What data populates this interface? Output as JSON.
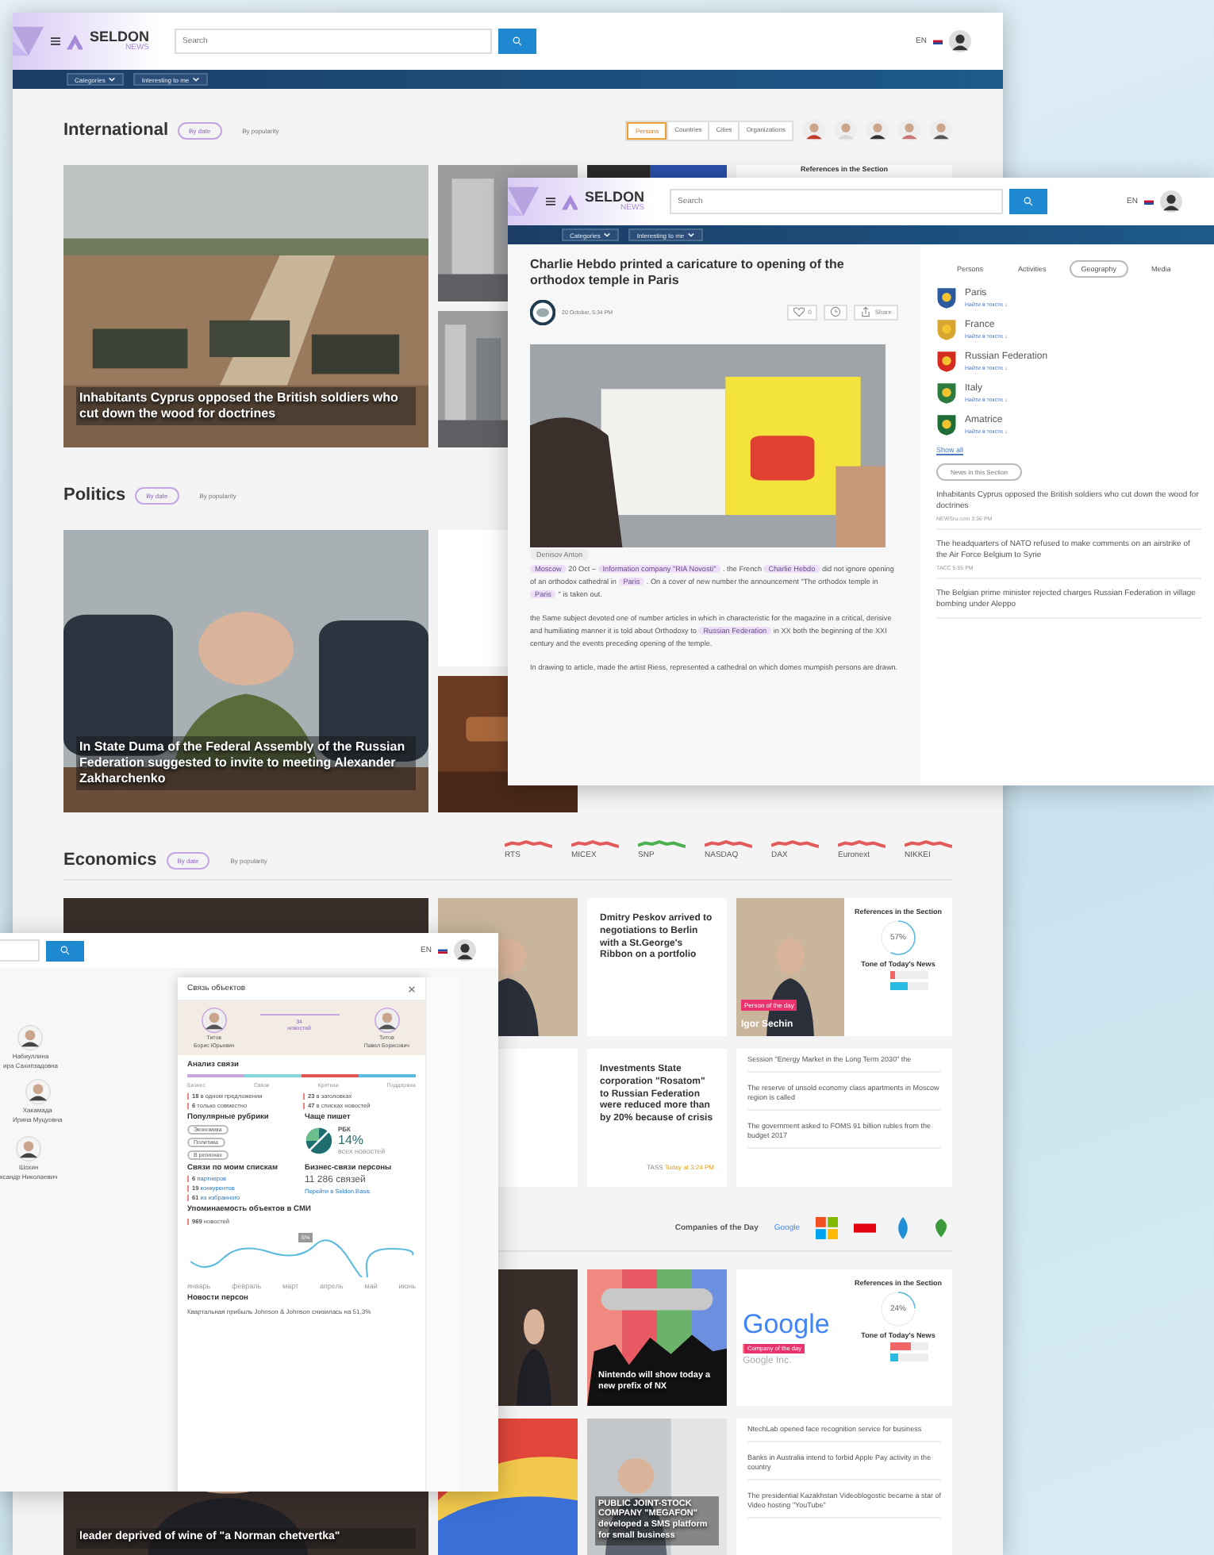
{
  "main": {
    "logo": "SELDON",
    "logo_sub": "NEWS",
    "search": {
      "placeholder": "Search"
    },
    "language": "EN",
    "nav": [
      "Categories",
      "Interesting to me"
    ],
    "international": {
      "title": "International",
      "sorts": [
        {
          "label": "By date",
          "selected": true
        },
        {
          "label": "By popularity",
          "selected": false
        }
      ],
      "filters": [
        {
          "label": "Persons",
          "selected": true
        },
        {
          "label": "Countries",
          "selected": false
        },
        {
          "label": "Cities",
          "selected": false
        },
        {
          "label": "Organizations",
          "selected": false
        }
      ],
      "lead": "Inhabitants Cyprus opposed the British soldiers who cut down the wood for doctrines",
      "refs": "References in the Section"
    },
    "politics": {
      "title": "Politics",
      "sorts": [
        {
          "label": "By date",
          "selected": true
        },
        {
          "label": "By popularity",
          "selected": false
        }
      ],
      "lead": "In State Duma of the Federal Assembly of the Russian Federation suggested to invite to meeting Alexander Zakharchenko"
    },
    "economics": {
      "title": "Economics",
      "sorts": [
        {
          "label": "By date",
          "selected": true
        },
        {
          "label": "By popularity",
          "selected": false
        }
      ],
      "markets": [
        {
          "name": "RTS",
          "color": "#e35b5b"
        },
        {
          "name": "MICEX",
          "color": "#e35b5b"
        },
        {
          "name": "SNP",
          "color": "#4caf50"
        },
        {
          "name": "NASDAQ",
          "color": "#e35b5b"
        },
        {
          "name": "DAX",
          "color": "#e35b5b"
        },
        {
          "name": "Euronext",
          "color": "#e35b5b"
        },
        {
          "name": "NIKKEI",
          "color": "#e35b5b"
        }
      ],
      "peskov": "Dmitry Peskov arrived to negotiations to Berlin with a St.George's Ribbon on a portfolio",
      "person": {
        "badge": "Person of the day",
        "name": "Igor Sechin",
        "refs": "References in the Section",
        "percent": "57%",
        "tone": "Tone of Today's News",
        "tone_bars": [
          {
            "kind": "negative",
            "level": 0.12
          },
          {
            "kind": "positive",
            "level": 0.45
          }
        ]
      },
      "rosatom": {
        "title": "Investments State corporation \"Rosatom\" to Russian Federation were reduced more than by 20% because of crisis",
        "source": "TASS",
        "time": "Today at 3:24 PM"
      },
      "news": [
        "Session \"Energy Market in the Long Term 2030\" the",
        "The reserve of unsold economy class apartments in Moscow region is called",
        "The government asked to FOMS 91 billion rubles from the budget 2017"
      ]
    },
    "companies": {
      "title": "Companies of the Day",
      "logos": [
        {
          "kind": "google",
          "label": "Google"
        },
        {
          "kind": "windows"
        },
        {
          "kind": "mts"
        },
        {
          "kind": "drop"
        },
        {
          "kind": "leaf"
        }
      ]
    },
    "nintendo": "Nintendo will show today a new prefix of NX",
    "company": {
      "logo": "Google",
      "badge": "Company of the day",
      "name": "Google Inc.",
      "refs": "References in the Section",
      "percent": "24%",
      "tone": "Tone of Today's News",
      "tone_bars": [
        {
          "kind": "negative",
          "level": 0.55
        },
        {
          "kind": "positive",
          "level": 0.2
        }
      ]
    },
    "megafon": "PUBLIC JOINT-STOCK COMPANY \"MEGAFON\" developed a SMS platform for small business",
    "news2": [
      "NtechLab opened face recognition service for business",
      "Banks in Australia intend to forbid Apple Pay activity in the country",
      "The presidential Kazakhstan Videoblogostic became a star of Video hosting \"YouTube\""
    ],
    "bottom_lead": "leader deprived of wine of \"a Norman chetvertka\""
  },
  "article": {
    "logo": "SELDON",
    "logo_sub": "NEWS",
    "search": {
      "placeholder": "Search"
    },
    "language": "EN",
    "nav": [
      "Categories",
      "Interesting to me"
    ],
    "title": "Charlie Hebdo printed a caricature to opening of the orthodox temple in Paris",
    "date": "20 October, 5:34 PM",
    "likes": "0",
    "share": "Share",
    "caption": "Denisov Anton",
    "paragraphs": [
      [
        {
          "t": "Moscow",
          "tag": true
        },
        {
          "t": " 20 Oct – ",
          "tag": false
        },
        {
          "t": "Information company \"RIA Novosti\"",
          "tag": true
        },
        {
          "t": " . the French ",
          "tag": false
        },
        {
          "t": "Charlie Hebdo",
          "tag": true
        },
        {
          "t": " did not ignore opening of an orthodox cathedral in ",
          "tag": false
        },
        {
          "t": "Paris",
          "tag": true
        },
        {
          "t": " . On a cover of new number the announcement \"The orthodox temple in ",
          "tag": false
        },
        {
          "t": "Paris",
          "tag": true
        },
        {
          "t": " \" is taken out.",
          "tag": false
        }
      ],
      [
        {
          "t": "the Same subject devoted one of number articles in which in characteristic for the magazine in a critical, derisive and humiliating manner it is told about Orthodoxy to ",
          "tag": false
        },
        {
          "t": "Russian Federation",
          "tag": true
        },
        {
          "t": " in XX both the beginning of the XXI century and the events preceding opening of the temple.",
          "tag": false
        }
      ],
      [
        {
          "t": "In drawing to article, made the artist Riess, represented a cathedral on which domes mumpish persons are drawn.",
          "tag": false
        }
      ]
    ],
    "tabs": [
      {
        "label": "Persons",
        "selected": false
      },
      {
        "label": "Activities",
        "selected": false
      },
      {
        "label": "Geography",
        "selected": true
      },
      {
        "label": "Media",
        "selected": false
      }
    ],
    "places": [
      {
        "name": "Paris",
        "color": "#2c5aa0",
        "find": "Найти в тексте ↓"
      },
      {
        "name": "France",
        "color": "#d9a531",
        "find": "Найти в тексте ↓"
      },
      {
        "name": "Russian Federation",
        "color": "#d52b1e",
        "find": "Найти в тексте ↓"
      },
      {
        "name": "Italy",
        "color": "#2c7a3e",
        "find": "Найти в тексте ↓"
      },
      {
        "name": "Amatrice",
        "color": "#1f6e35",
        "find": "Найти в тексте ↓"
      }
    ],
    "show_all": "Show all",
    "section_button": "News in this Section",
    "news": [
      {
        "title": "Inhabitants Cyprus opposed the British soldiers who cut down the wood for doctrines",
        "source": "NEWSru.com 3:56 PM"
      },
      {
        "title": "The headquarters of NATO refused to make comments on an airstrike of the Air Force Belgium to Syrie",
        "source": "ТАСС 5:55 PM"
      },
      {
        "title": "The Belgian prime minister rejected charges Russian Federation in village bombing under Aleppo"
      }
    ]
  },
  "connections": {
    "language": "EN",
    "graph": [
      {
        "surname": "Набиуллина",
        "given": "ира Сахипзадовна"
      },
      {
        "surname": "Хакамада",
        "given": "Ирина Муцуовна"
      },
      {
        "surname": "Шохин",
        "given": "ксандр Николаевич"
      }
    ],
    "title": "Связь объектов",
    "left": {
      "surname": "Титов",
      "name": "Борис Юрьевич"
    },
    "right": {
      "surname": "Титов",
      "name": "Павел Борисович"
    },
    "count": "34",
    "count_label": "новостей",
    "analysis": "Анализ связи",
    "segments": [
      {
        "color": "#c9a6dc"
      },
      {
        "color": "#86d6dc"
      },
      {
        "color": "#e0574f"
      },
      {
        "color": "#5bbbe0"
      }
    ],
    "segment_labels": [
      "Бизнес",
      "Связи",
      "Критика",
      "Поддержка"
    ],
    "stats": [
      {
        "n": "18",
        "t": "в одном предложении"
      },
      {
        "n": "23",
        "t": "в заголовках"
      },
      {
        "n": "6",
        "t": "только совместно"
      },
      {
        "n": "47",
        "t": "в списках новостей"
      }
    ],
    "rubrics_title": "Популярные рубрики",
    "rubrics": [
      "Экономика",
      "Политика",
      "В регионах"
    ],
    "writes_title": "Чаще пишет",
    "writes_source": "РБК",
    "writes_percent": "14%",
    "writes_note": "всех новостей",
    "lists_title": "Связи по моим спискам",
    "lists": [
      {
        "n": "6",
        "t": "партнеров"
      },
      {
        "n": "19",
        "t": "конкурентов"
      },
      {
        "n": "61",
        "t": "из избранного"
      }
    ],
    "business_title": "Бизнес-связи персоны",
    "business_count": "11 286 связей",
    "business_link": "Перейти в Seldon.Basis",
    "mentions_title": "Упоминаемость объектов в СМИ",
    "mentions_count": "969",
    "mentions_label": "новостей",
    "tooltip": "5%",
    "months": [
      "январь",
      "февраль",
      "март",
      "апрель",
      "май",
      "июнь"
    ],
    "news_title": "Новости персон",
    "news": [
      "Квартальная прибыль Johnson & Johnson снизилась на 51,3%"
    ]
  }
}
